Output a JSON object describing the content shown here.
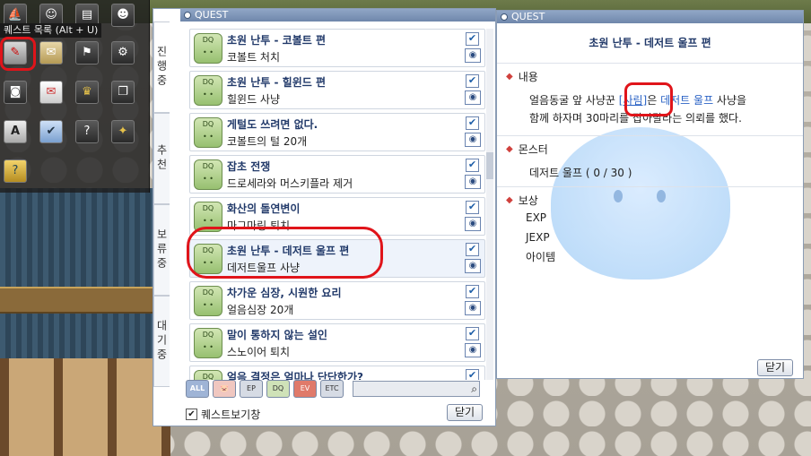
{
  "shortcut": {
    "tooltip": "퀘스트 목록 (Alt + U)"
  },
  "quest_window": {
    "title": "QUEST",
    "tabs": [
      {
        "label": "진행중"
      },
      {
        "label": "추천"
      },
      {
        "label": "보류중"
      },
      {
        "label": "대기중"
      }
    ],
    "quests": [
      {
        "title": "초원 난투 - 코볼트 편",
        "sub": "코볼트 처치",
        "icon": "quest-icon"
      },
      {
        "title": "초원 난투 - 힐윈드 편",
        "sub": "힐윈드 사냥",
        "icon": "quest-icon"
      },
      {
        "title": "게털도 쓰려면 없다.",
        "sub": "코볼트의 털 20개",
        "icon": "quest-icon"
      },
      {
        "title": "잡초 전쟁",
        "sub": "드로세라와 머스키플라 제거",
        "icon": "quest-icon"
      },
      {
        "title": "화산의 돌연변이",
        "sub": "마그마링 퇴치",
        "icon": "quest-icon"
      },
      {
        "title": "초원 난투 - 데저트 울프 편",
        "sub": "데저트울프 사냥",
        "icon": "quest-icon"
      },
      {
        "title": "차가운 심장, 시원한 요리",
        "sub": "얼음심장 20개",
        "icon": "quest-icon"
      },
      {
        "title": "말이 통하지 않는 설인",
        "sub": "스노이어 퇴치",
        "icon": "quest-icon"
      },
      {
        "title": "얼음 결정은 얼마나 단단한가?",
        "sub": "",
        "icon": "quest-icon"
      }
    ],
    "filters": [
      "ALL",
      "",
      "",
      "",
      "",
      "ETC"
    ],
    "show_quest_label": "퀘스트보기창",
    "close_label": "닫기"
  },
  "detail_window": {
    "title": "QUEST",
    "quest_title": "초원 난투 - 데저트 울프 편",
    "content_header": "내용",
    "content_pre": "얼음동굴 앞 사냥꾼",
    "content_link": "[사림]",
    "content_mid": "은 ",
    "content_monster": "데저트 울프",
    "content_post": " 사냥을",
    "content_line2": "함께 하자며 30마리를 잡아달라는 의뢰를 했다.",
    "monster_header": "몬스터",
    "monster_line": "데저트 울프 ( 0 / 30 )",
    "reward_header": "보상",
    "rewards": [
      "EXP",
      "JEXP",
      "아이템"
    ],
    "close_label": "닫기"
  },
  "colors": {
    "highlight_ring": "#e0141a",
    "titlebar": "#7f95b8",
    "quest_title": "#223a6a",
    "link": "#2b63c5"
  }
}
